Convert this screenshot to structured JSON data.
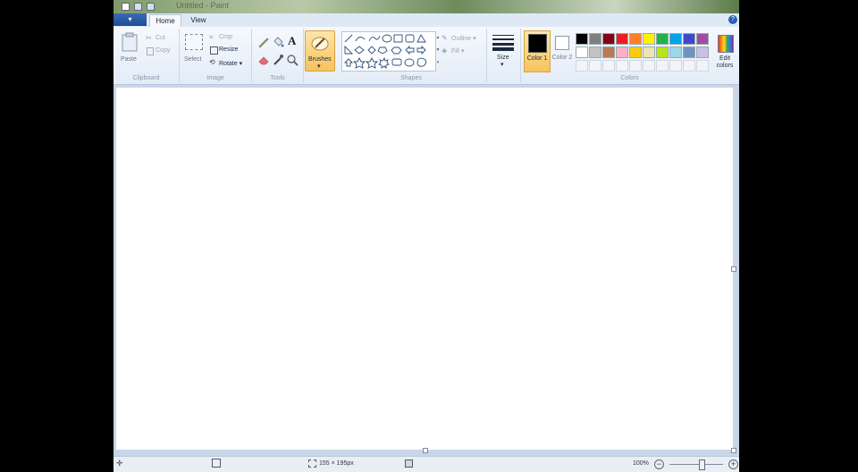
{
  "title": {
    "text": "Untitled - Paint"
  },
  "tabs": {
    "file": "▾",
    "home": "Home",
    "view": "View"
  },
  "help": "?",
  "clipboard": {
    "paste": "Paste",
    "cut": "Cut",
    "copy": "Copy",
    "group": "Clipboard"
  },
  "image": {
    "select": "Select",
    "crop": "Crop",
    "resize": "Resize",
    "rotate": "Rotate ▾",
    "group": "Image"
  },
  "tools": {
    "group": "Tools",
    "text_glyph": "A"
  },
  "brushes": {
    "label": "Brushes"
  },
  "shapes": {
    "outline": "Outline ▾",
    "fill": "Fill ▾",
    "group": "Shapes"
  },
  "size": {
    "label": "Size"
  },
  "colors": {
    "color1": "Color 1",
    "color2": "Color 2",
    "edit": "Edit colors",
    "group": "Colors",
    "color1_value": "#000000",
    "color2_value": "#ffffff",
    "palette_row1": [
      "#000000",
      "#7f7f7f",
      "#880015",
      "#ed1c24",
      "#ff7f27",
      "#fff200",
      "#22b14c",
      "#00a2e8",
      "#3f48cc",
      "#a349a4"
    ],
    "palette_row2": [
      "#ffffff",
      "#c3c3c3",
      "#b97a57",
      "#ffaec9",
      "#ffc90e",
      "#efe4b0",
      "#b5e61d",
      "#99d9ea",
      "#7092be",
      "#c8bfe7"
    ]
  },
  "status": {
    "selection_size": "155 × 195px",
    "zoom": "100%"
  }
}
